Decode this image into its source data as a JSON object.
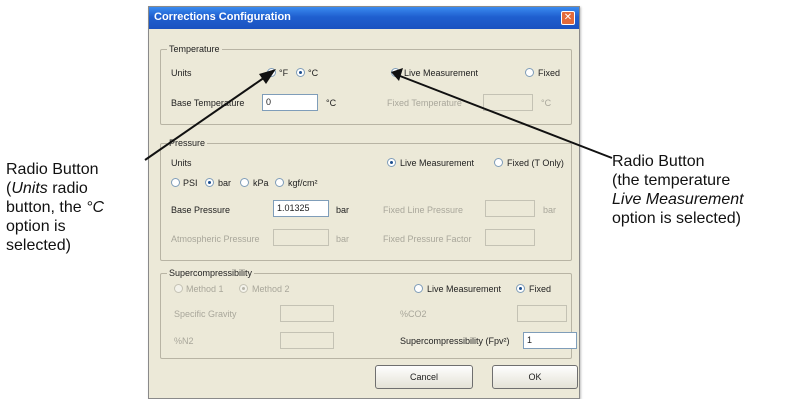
{
  "dialog": {
    "title": "Corrections Configuration",
    "close_icon": "close-icon"
  },
  "temperature": {
    "group_title": "Temperature",
    "units_label": "Units",
    "unit_f": "°F",
    "unit_c": "°C",
    "selected_unit": "°C",
    "live_measurement": "Live Measurement",
    "fixed": "Fixed",
    "selected_mode": "Live Measurement",
    "base_temperature_label": "Base Temperature",
    "base_temperature_value": "0",
    "base_temperature_unit": "°C",
    "fixed_temperature_label": "Fixed Temperature",
    "fixed_temperature_value": "",
    "fixed_temperature_unit": "°C"
  },
  "pressure": {
    "group_title": "Pressure",
    "units_label": "Units",
    "live_measurement": "Live Measurement",
    "fixed_t_only": "Fixed (T Only)",
    "selected_mode": "Live Measurement",
    "unit_psi": "PSI",
    "unit_bar": "bar",
    "unit_kpa": "kPa",
    "unit_kgf": "kgf/cm²",
    "selected_unit": "bar",
    "base_pressure_label": "Base Pressure",
    "base_pressure_value": "1.01325",
    "base_pressure_unit": "bar",
    "fixed_line_pressure_label": "Fixed Line Pressure",
    "fixed_line_pressure_value": "",
    "fixed_line_pressure_unit": "bar",
    "atmospheric_pressure_label": "Atmospheric Pressure",
    "atmospheric_pressure_value": "",
    "atmospheric_pressure_unit": "bar",
    "fixed_pressure_factor_label": "Fixed Pressure Factor",
    "fixed_pressure_factor_value": ""
  },
  "supercompressibility": {
    "group_title": "Supercompressibility",
    "method1": "Method 1",
    "method2": "Method 2",
    "live_measurement": "Live Measurement",
    "fixed": "Fixed",
    "selected_mode": "Fixed",
    "specific_gravity_label": "Specific Gravity",
    "specific_gravity_value": "",
    "co2_label": "%CO2",
    "co2_value": "",
    "n2_label": "%N2",
    "n2_value": "",
    "fpv_label": "Supercompressibility (Fpv²)",
    "fpv_value": "1"
  },
  "buttons": {
    "cancel": "Cancel",
    "ok": "OK"
  },
  "annotations": {
    "left_line1": "Radio Button",
    "left_line2_italic": "Units",
    "left_line2_rest": " radio",
    "left_line3": "button, the ",
    "left_line3_italic": "°C",
    "left_line4": "option is",
    "left_line5": "selected)",
    "left_open_paren": "(",
    "right_line1": "Radio Button",
    "right_line2": "(the temperature",
    "right_line3_italic": "Live Measurement",
    "right_line4": "option is selected)"
  }
}
